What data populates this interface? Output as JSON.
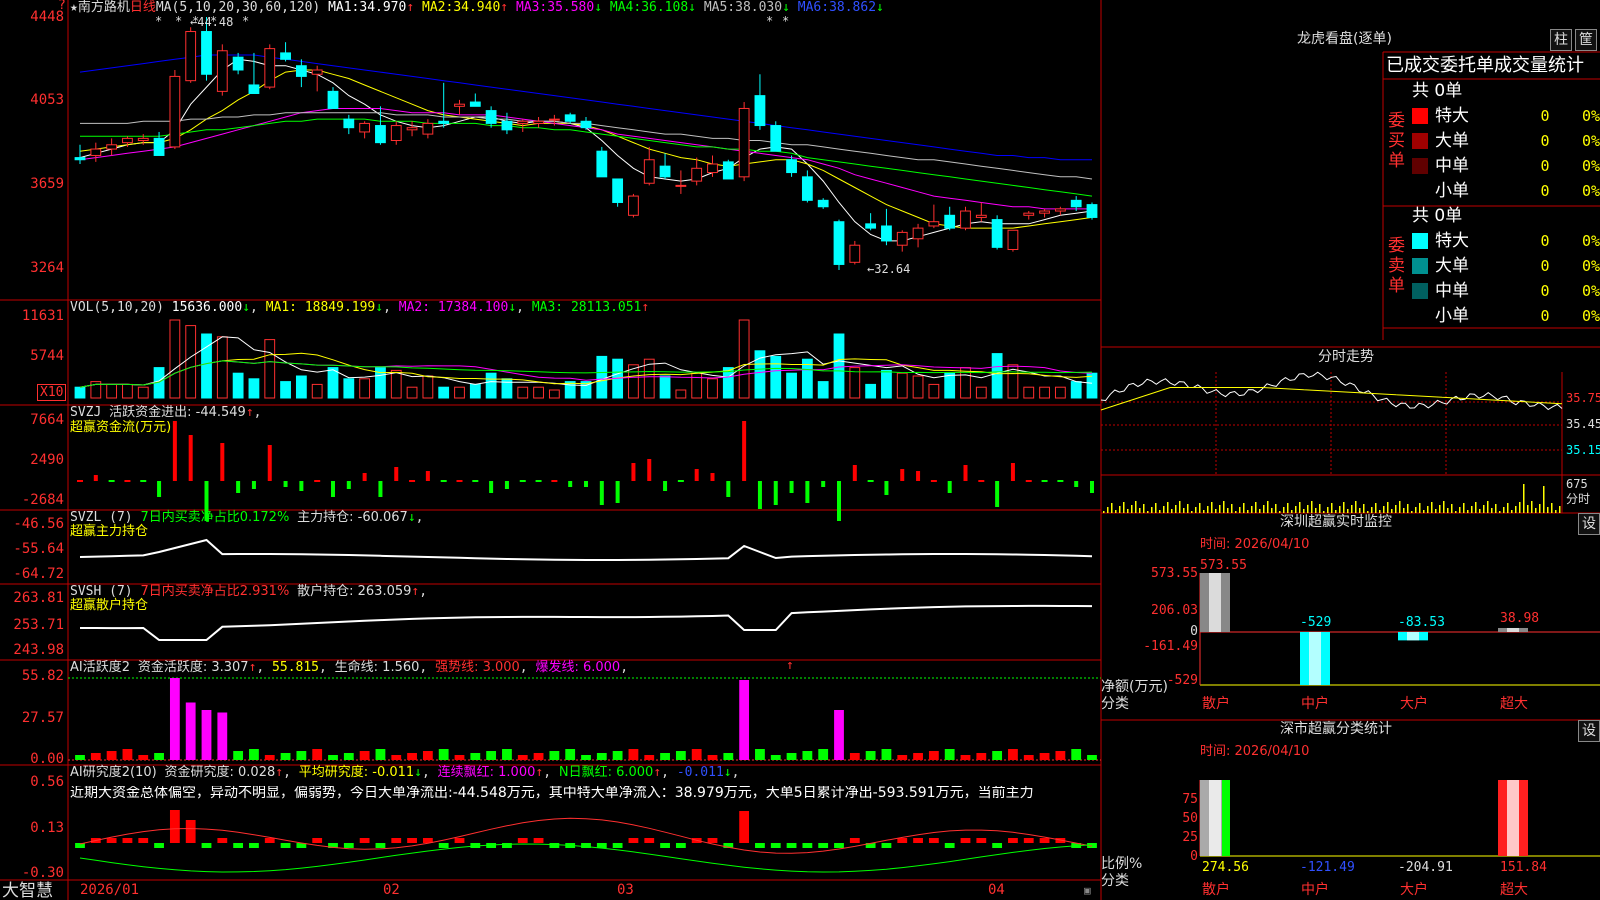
{
  "colors": {
    "up": "#ff3030",
    "down": "#00ffff",
    "bg": "#000000",
    "frame": "#c00000",
    "ma1": "#ffffff",
    "ma2": "#ffff00",
    "ma3": "#ff00ff",
    "ma4": "#00ff00",
    "ma5": "#c0c0c0",
    "ma6": "#0000ff",
    "pos": "#ff0000",
    "neg": "#00ff00",
    "pink": "#ff00ff"
  },
  "main": {
    "stock_name": "南方路机",
    "period": "日线",
    "ma_label": "MA(5,10,20,30,60,120)",
    "ma": [
      {
        "name": "MA1:",
        "value": "34.970",
        "arrow": "↑"
      },
      {
        "name": "MA2:",
        "value": "34.940",
        "arrow": "↑"
      },
      {
        "name": "MA3:",
        "value": "35.580",
        "arrow": "↓"
      },
      {
        "name": "MA4:",
        "value": "36.108",
        "arrow": "↓"
      },
      {
        "name": "MA5:",
        "value": "38.030",
        "arrow": "↓"
      },
      {
        "name": "MA6:",
        "value": "38.862",
        "arrow": "↓"
      }
    ],
    "high_label": "44.48",
    "low_label": "32.64",
    "price_ticks": [
      "4448",
      "4053",
      "3659",
      "3264"
    ],
    "stars": [
      "*",
      "*",
      "*",
      "*",
      "*",
      "*",
      "*"
    ]
  },
  "vol": {
    "label": "VOL(5,10,20)",
    "value": "15636.000",
    "arrow": "↓",
    "ma1": "MA1: 18849.199",
    "ma1_arrow": "↓",
    "ma2": "MA2: 17384.100",
    "ma2_arrow": "↓",
    "ma3": "MA3: 28113.051",
    "ma3_arrow": "↑",
    "ticks": [
      "11631",
      "5744"
    ],
    "unit": "X10"
  },
  "svzj": {
    "title": "SVZJ",
    "label": "活跃资金进出: -44.549",
    "arrow": "↑",
    "sep": ",",
    "sub": "超赢资金流(万元)",
    "ticks": [
      "7664",
      "2490",
      "-2684"
    ]
  },
  "svzl": {
    "title": "SVZL (7)",
    "label1": "7日内买卖净占比0.172%",
    "label2": "主力持仓: -60.067",
    "arrow": "↓",
    "sep": ",",
    "sub": "超赢主力持仓",
    "ticks": [
      "-46.56",
      "-55.64",
      "-64.72"
    ]
  },
  "svsh": {
    "title": "SVSH (7)",
    "label1": "7日内买卖净占比2.931%",
    "label2": "散户持仓: 263.059",
    "arrow": "↑",
    "sep": ",",
    "sub": "超赢散户持仓",
    "ticks": [
      "263.81",
      "253.71",
      "243.98"
    ]
  },
  "ai1": {
    "title": "AI活跃度2",
    "label1": "资金活跃度: 3.307",
    "arrow1": "↑",
    "label2": "55.815",
    "label3": "生命线: 1.560",
    "label4": "强势线: 3.000",
    "label5": "爆发线: 6.000",
    "sep": ",",
    "arrow_mark": "↑",
    "ticks": [
      "55.82",
      "27.57",
      "0.00"
    ]
  },
  "ai2": {
    "title": "AI研究度2(10)",
    "label1": "资金研究度: 0.028",
    "arrow1": "↑",
    "label2": "平均研究度: -0.011",
    "arrow2": "↓",
    "label3": "连续飘红: 1.000",
    "arrow3": "↑",
    "label4": "N日飘红: 6.000",
    "arrow4": "↑",
    "label5": "-0.011",
    "arrow5": "↓",
    "sep": ",",
    "comment": "近期大资金总体偏空，异动不明显，偏弱势，今日大单净流出:-44.548万元，其中特大单净流入：38.979万元，大单5日累计净出-593.591万元，当前主力",
    "ticks": [
      "0.56",
      "0.13",
      "-0.30"
    ]
  },
  "time_axis": {
    "labels": [
      "2026/01",
      "02",
      "03",
      "04"
    ]
  },
  "brand": "大智慧",
  "corner_mark": "?",
  "candles": [
    {
      "o": 3790,
      "h": 3850,
      "l": 3760,
      "c": 3780
    },
    {
      "o": 3800,
      "h": 3860,
      "l": 3770,
      "c": 3830
    },
    {
      "o": 3830,
      "h": 3880,
      "l": 3800,
      "c": 3850
    },
    {
      "o": 3860,
      "h": 3890,
      "l": 3840,
      "c": 3880
    },
    {
      "o": 3870,
      "h": 3900,
      "l": 3850,
      "c": 3880
    },
    {
      "o": 3880,
      "h": 3910,
      "l": 3800,
      "c": 3800
    },
    {
      "o": 3840,
      "h": 4200,
      "l": 3830,
      "c": 4170
    },
    {
      "o": 4150,
      "h": 4400,
      "l": 4140,
      "c": 4380
    },
    {
      "o": 4380,
      "h": 4448,
      "l": 4150,
      "c": 4180
    },
    {
      "o": 4100,
      "h": 4320,
      "l": 4080,
      "c": 4290
    },
    {
      "o": 4260,
      "h": 4280,
      "l": 4180,
      "c": 4200
    },
    {
      "o": 4130,
      "h": 4280,
      "l": 4100,
      "c": 4090
    },
    {
      "o": 4120,
      "h": 4320,
      "l": 4110,
      "c": 4300
    },
    {
      "o": 4280,
      "h": 4330,
      "l": 4240,
      "c": 4250
    },
    {
      "o": 4220,
      "h": 4250,
      "l": 4120,
      "c": 4170
    },
    {
      "o": 4180,
      "h": 4220,
      "l": 4100,
      "c": 4200
    },
    {
      "o": 4100,
      "h": 4120,
      "l": 4020,
      "c": 4020
    },
    {
      "o": 3970,
      "h": 3990,
      "l": 3900,
      "c": 3930
    },
    {
      "o": 3910,
      "h": 3960,
      "l": 3880,
      "c": 3950
    },
    {
      "o": 3940,
      "h": 4030,
      "l": 3850,
      "c": 3860
    },
    {
      "o": 3870,
      "h": 3960,
      "l": 3850,
      "c": 3940
    },
    {
      "o": 3920,
      "h": 3960,
      "l": 3890,
      "c": 3930
    },
    {
      "o": 3900,
      "h": 3970,
      "l": 3880,
      "c": 3950
    },
    {
      "o": 3960,
      "h": 4140,
      "l": 3930,
      "c": 3950
    },
    {
      "o": 4030,
      "h": 4060,
      "l": 3990,
      "c": 4040
    },
    {
      "o": 4050,
      "h": 4090,
      "l": 4030,
      "c": 4030
    },
    {
      "o": 4010,
      "h": 4030,
      "l": 3930,
      "c": 3950
    },
    {
      "o": 3960,
      "h": 4000,
      "l": 3900,
      "c": 3920
    },
    {
      "o": 3950,
      "h": 3970,
      "l": 3910,
      "c": 3960
    },
    {
      "o": 3950,
      "h": 3980,
      "l": 3930,
      "c": 3960
    },
    {
      "o": 3970,
      "h": 3990,
      "l": 3940,
      "c": 3970
    },
    {
      "o": 3990,
      "h": 4000,
      "l": 3950,
      "c": 3960
    },
    {
      "o": 3960,
      "h": 3980,
      "l": 3920,
      "c": 3930
    },
    {
      "o": 3820,
      "h": 3840,
      "l": 3700,
      "c": 3700
    },
    {
      "o": 3690,
      "h": 3690,
      "l": 3560,
      "c": 3580
    },
    {
      "o": 3520,
      "h": 3620,
      "l": 3510,
      "c": 3610
    },
    {
      "o": 3670,
      "h": 3840,
      "l": 3660,
      "c": 3780
    },
    {
      "o": 3750,
      "h": 3810,
      "l": 3690,
      "c": 3700
    },
    {
      "o": 3660,
      "h": 3730,
      "l": 3620,
      "c": 3660
    },
    {
      "o": 3680,
      "h": 3790,
      "l": 3660,
      "c": 3740
    },
    {
      "o": 3720,
      "h": 3800,
      "l": 3700,
      "c": 3760
    },
    {
      "o": 3770,
      "h": 3780,
      "l": 3690,
      "c": 3690
    },
    {
      "o": 3700,
      "h": 4050,
      "l": 3680,
      "c": 4020
    },
    {
      "o": 4080,
      "h": 4180,
      "l": 3920,
      "c": 3940
    },
    {
      "o": 3940,
      "h": 3960,
      "l": 3820,
      "c": 3820
    },
    {
      "o": 3780,
      "h": 3800,
      "l": 3700,
      "c": 3720
    },
    {
      "o": 3700,
      "h": 3730,
      "l": 3580,
      "c": 3590
    },
    {
      "o": 3590,
      "h": 3600,
      "l": 3550,
      "c": 3560
    },
    {
      "o": 3490,
      "h": 3500,
      "l": 3264,
      "c": 3290
    },
    {
      "o": 3300,
      "h": 3400,
      "l": 3290,
      "c": 3380
    },
    {
      "o": 3480,
      "h": 3530,
      "l": 3450,
      "c": 3460
    },
    {
      "o": 3470,
      "h": 3550,
      "l": 3380,
      "c": 3400
    },
    {
      "o": 3380,
      "h": 3450,
      "l": 3350,
      "c": 3440
    },
    {
      "o": 3410,
      "h": 3480,
      "l": 3370,
      "c": 3460
    },
    {
      "o": 3470,
      "h": 3570,
      "l": 3460,
      "c": 3490
    },
    {
      "o": 3520,
      "h": 3560,
      "l": 3450,
      "c": 3460
    },
    {
      "o": 3460,
      "h": 3560,
      "l": 3450,
      "c": 3540
    },
    {
      "o": 3510,
      "h": 3580,
      "l": 3490,
      "c": 3520
    },
    {
      "o": 3500,
      "h": 3520,
      "l": 3360,
      "c": 3370
    },
    {
      "o": 3360,
      "h": 3450,
      "l": 3350,
      "c": 3450
    },
    {
      "o": 3520,
      "h": 3540,
      "l": 3500,
      "c": 3530
    },
    {
      "o": 3530,
      "h": 3550,
      "l": 3510,
      "c": 3540
    },
    {
      "o": 3540,
      "h": 3560,
      "l": 3520,
      "c": 3550
    },
    {
      "o": 3590,
      "h": 3610,
      "l": 3540,
      "c": 3560
    },
    {
      "o": 3570,
      "h": 3580,
      "l": 3500,
      "c": 3510
    }
  ],
  "ma_lines": {
    "ma1": [
      3790,
      3810,
      3830,
      3850,
      3860,
      3860,
      3920,
      4040,
      4120,
      4200,
      4250,
      4240,
      4220,
      4220,
      4200,
      4180,
      4140,
      4080,
      4040,
      3990,
      3960,
      3940,
      3930,
      3940,
      3960,
      3980,
      3980,
      3960,
      3950,
      3960,
      3960,
      3950,
      3930,
      3870,
      3800,
      3740,
      3700,
      3690,
      3680,
      3690,
      3720,
      3740,
      3790,
      3830,
      3840,
      3830,
      3760,
      3680,
      3580,
      3490,
      3430,
      3400,
      3400,
      3420,
      3440,
      3460,
      3480,
      3490,
      3480,
      3480,
      3480,
      3500,
      3520,
      3530,
      3540
    ],
    "ma2": [
      3820,
      3830,
      3840,
      3850,
      3860,
      3860,
      3880,
      3920,
      3970,
      4010,
      4060,
      4100,
      4150,
      4190,
      4200,
      4200,
      4180,
      4160,
      4130,
      4100,
      4070,
      4040,
      4010,
      3990,
      3980,
      3970,
      3960,
      3950,
      3940,
      3950,
      3950,
      3950,
      3940,
      3920,
      3890,
      3860,
      3830,
      3810,
      3790,
      3780,
      3760,
      3750,
      3760,
      3770,
      3780,
      3780,
      3760,
      3730,
      3690,
      3650,
      3610,
      3570,
      3540,
      3510,
      3480,
      3470,
      3460,
      3460,
      3460,
      3460,
      3470,
      3480,
      3490,
      3500,
      3510
    ],
    "ma3": [
      3780,
      3790,
      3800,
      3810,
      3820,
      3830,
      3840,
      3860,
      3880,
      3900,
      3920,
      3940,
      3960,
      3980,
      4000,
      4010,
      4020,
      4020,
      4020,
      4020,
      4010,
      4000,
      4000,
      4000,
      3990,
      3990,
      3990,
      3980,
      3970,
      3960,
      3950,
      3940,
      3930,
      3920,
      3900,
      3890,
      3880,
      3870,
      3860,
      3850,
      3840,
      3830,
      3820,
      3810,
      3800,
      3790,
      3780,
      3760,
      3740,
      3710,
      3690,
      3670,
      3650,
      3630,
      3610,
      3600,
      3590,
      3580,
      3570,
      3560,
      3560,
      3550,
      3550,
      3550,
      3550
    ],
    "ma4": [
      3890,
      3890,
      3890,
      3890,
      3890,
      3890,
      3900,
      3910,
      3920,
      3920,
      3930,
      3940,
      3950,
      3960,
      3960,
      3970,
      3970,
      3970,
      3970,
      3960,
      3960,
      3960,
      3950,
      3950,
      3950,
      3950,
      3940,
      3940,
      3930,
      3930,
      3920,
      3920,
      3910,
      3900,
      3890,
      3880,
      3870,
      3860,
      3850,
      3840,
      3840,
      3830,
      3830,
      3820,
      3820,
      3810,
      3790,
      3780,
      3770,
      3760,
      3750,
      3740,
      3730,
      3720,
      3710,
      3700,
      3690,
      3680,
      3670,
      3660,
      3650,
      3640,
      3630,
      3620,
      3610
    ],
    "ma5": [
      3950,
      3950,
      3950,
      3950,
      3960,
      3960,
      3960,
      3970,
      3970,
      3980,
      3980,
      3990,
      3990,
      4000,
      4000,
      4000,
      4000,
      4000,
      4000,
      4000,
      3990,
      3990,
      3990,
      3980,
      3980,
      3980,
      3970,
      3970,
      3960,
      3960,
      3960,
      3950,
      3950,
      3940,
      3930,
      3920,
      3910,
      3900,
      3900,
      3890,
      3880,
      3880,
      3870,
      3870,
      3860,
      3850,
      3850,
      3840,
      3830,
      3820,
      3810,
      3800,
      3790,
      3780,
      3780,
      3770,
      3760,
      3750,
      3740,
      3730,
      3720,
      3710,
      3700,
      3700,
      3690
    ],
    "ma6": [
      4190,
      4200,
      4210,
      4220,
      4230,
      4240,
      4250,
      4260,
      4270,
      4270,
      4270,
      4270,
      4260,
      4250,
      4240,
      4230,
      4220,
      4210,
      4200,
      4190,
      4180,
      4170,
      4160,
      4150,
      4140,
      4130,
      4120,
      4110,
      4100,
      4090,
      4080,
      4070,
      4060,
      4050,
      4040,
      4030,
      4020,
      4010,
      4000,
      3990,
      3980,
      3970,
      3960,
      3950,
      3940,
      3930,
      3920,
      3910,
      3900,
      3890,
      3880,
      3870,
      3860,
      3850,
      3840,
      3830,
      3820,
      3810,
      3800,
      3800,
      3790,
      3790,
      3780,
      3780,
      3780
    ]
  },
  "right": {
    "lhb": {
      "title": "龙虎看盘(逐单)",
      "btn1": "柱",
      "btn2": "筐"
    },
    "stats_header": "已成交委托单成交量统计",
    "buy": {
      "side": "委买单",
      "total": "共 0单",
      "rows": [
        {
          "label": "特大",
          "v": "0",
          "p": "0%"
        },
        {
          "label": "大单",
          "v": "0",
          "p": "0%"
        },
        {
          "label": "中单",
          "v": "0",
          "p": "0%"
        },
        {
          "label": "小单",
          "v": "0",
          "p": "0%"
        }
      ]
    },
    "sell": {
      "side": "委卖单",
      "total": "共 0单",
      "rows": [
        {
          "label": "特大",
          "v": "0",
          "p": "0%"
        },
        {
          "label": "大单",
          "v": "0",
          "p": "0%"
        },
        {
          "label": "中单",
          "v": "0",
          "p": "0%"
        },
        {
          "label": "小单",
          "v": "0",
          "p": "0%"
        }
      ]
    },
    "intraday": {
      "title": "分时走势",
      "ticks": [
        "35.75",
        "35.45",
        "35.15"
      ],
      "vol_tick": "675",
      "vol_unit": "分时"
    },
    "monitor": {
      "title": "深圳超赢实时监控",
      "btn": "设",
      "time": "时间: 2026/04/10",
      "ticks": [
        "573.55",
        "206.03",
        "0",
        "-161.49",
        "-529"
      ],
      "ylabel1": "净额(万元)",
      "ylabel2": "分类",
      "cats": [
        "散户",
        "中户",
        "大户",
        "超大"
      ],
      "values": [
        "573.55",
        "-529",
        "-83.53",
        "38.98"
      ]
    },
    "classify": {
      "title": "深市超赢分类统计",
      "btn": "设",
      "time": "时间: 2026/04/10",
      "ticks": [
        "75",
        "50",
        "25",
        "0"
      ],
      "ylabel1": "比例%",
      "ylabel2": "分类",
      "cats": [
        "散户",
        "中户",
        "大户",
        "超大"
      ],
      "values": [
        "274.56",
        "-121.49",
        "-204.91",
        "151.84"
      ]
    }
  }
}
